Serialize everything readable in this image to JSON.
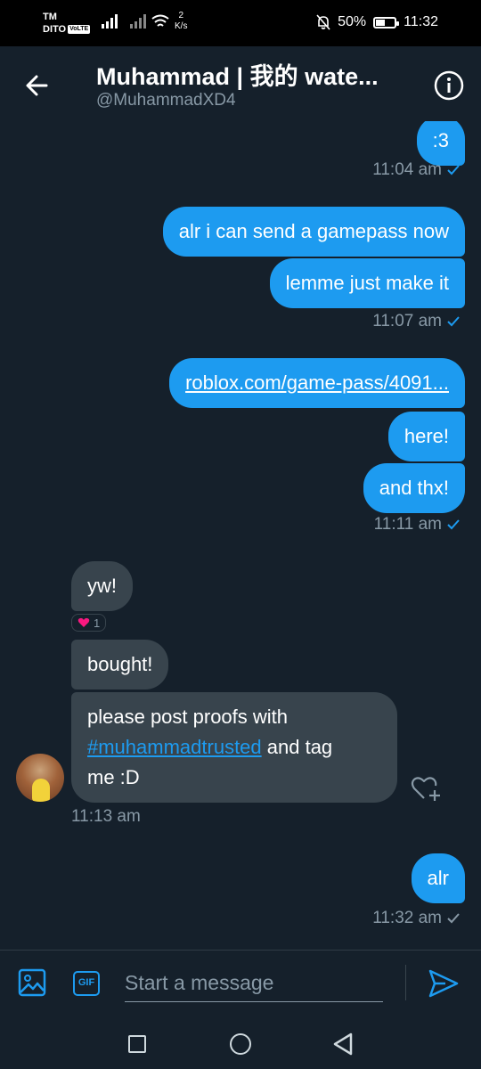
{
  "status_bar": {
    "carrier_top": "TM",
    "carrier_bottom": "DITO",
    "volte": "VoLTE",
    "speed_value": "2",
    "speed_unit": "K/s",
    "battery": "50%",
    "battery_level": 0.5,
    "time": "11:32"
  },
  "header": {
    "title": "Muhammad | 我的 wate...",
    "handle": "@MuhammadXD4"
  },
  "messages": {
    "m1": ":3",
    "ts1": "11:04 am",
    "m2": "alr i can send a gamepass now",
    "m3": "lemme just make it",
    "ts2": "11:07 am",
    "m4": "roblox.com/game-pass/4091...",
    "m5": "here!",
    "m6": "and thx!",
    "ts3": "11:11 am",
    "r1": "yw!",
    "reaction_count": "1",
    "r2": "bought!",
    "r3_line1": "please post proofs with",
    "r3_hashtag": "#muhammadtrusted",
    "r3_mid": " and tag",
    "r3_line3": "me :D",
    "ts4": "11:13 am",
    "m7": "alr",
    "ts5": "11:32 am"
  },
  "composer": {
    "placeholder": "Start a message",
    "gif_label": "GIF"
  },
  "colors": {
    "accent": "#1d9bf0",
    "background": "#15202b",
    "incoming_bubble": "#38444d",
    "muted": "#8899a6",
    "reaction_heart": "#f91880"
  }
}
